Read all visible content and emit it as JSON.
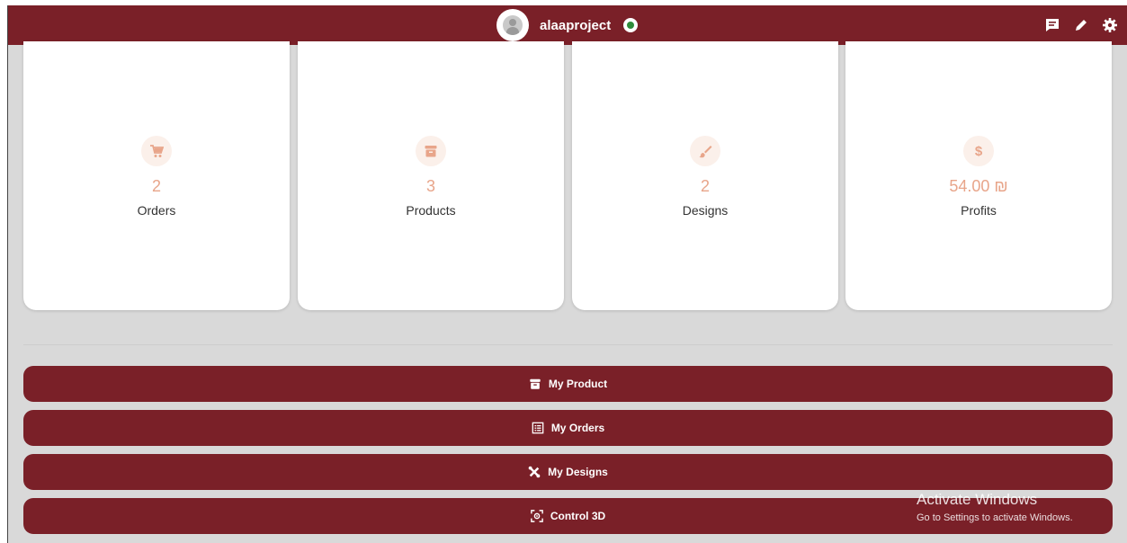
{
  "header": {
    "username": "alaaproject",
    "icons": [
      "avatar-icon",
      "status-badge-icon",
      "message-icon",
      "edit-icon",
      "settings-icon"
    ]
  },
  "colors": {
    "primary": "#7a2028",
    "accent": "#e8a58a",
    "icon_bg": "#fbf0ea",
    "background": "#d9d9d9"
  },
  "stats": [
    {
      "icon": "cart-icon",
      "value": "2",
      "label": "Orders"
    },
    {
      "icon": "archive-icon",
      "value": "3",
      "label": "Products"
    },
    {
      "icon": "brush-icon",
      "value": "2",
      "label": "Designs"
    },
    {
      "icon": "dollar-icon",
      "value": "54.00 ₪",
      "label": "Profits"
    }
  ],
  "actions": [
    {
      "icon": "archive-icon",
      "label": "My Product"
    },
    {
      "icon": "list-icon",
      "label": "My Orders"
    },
    {
      "icon": "tools-icon",
      "label": "My Designs"
    },
    {
      "icon": "3d-rotate-icon",
      "label": "Control 3D"
    }
  ],
  "watermark": {
    "title": "Activate Windows",
    "subtitle": "Go to Settings to activate Windows."
  }
}
